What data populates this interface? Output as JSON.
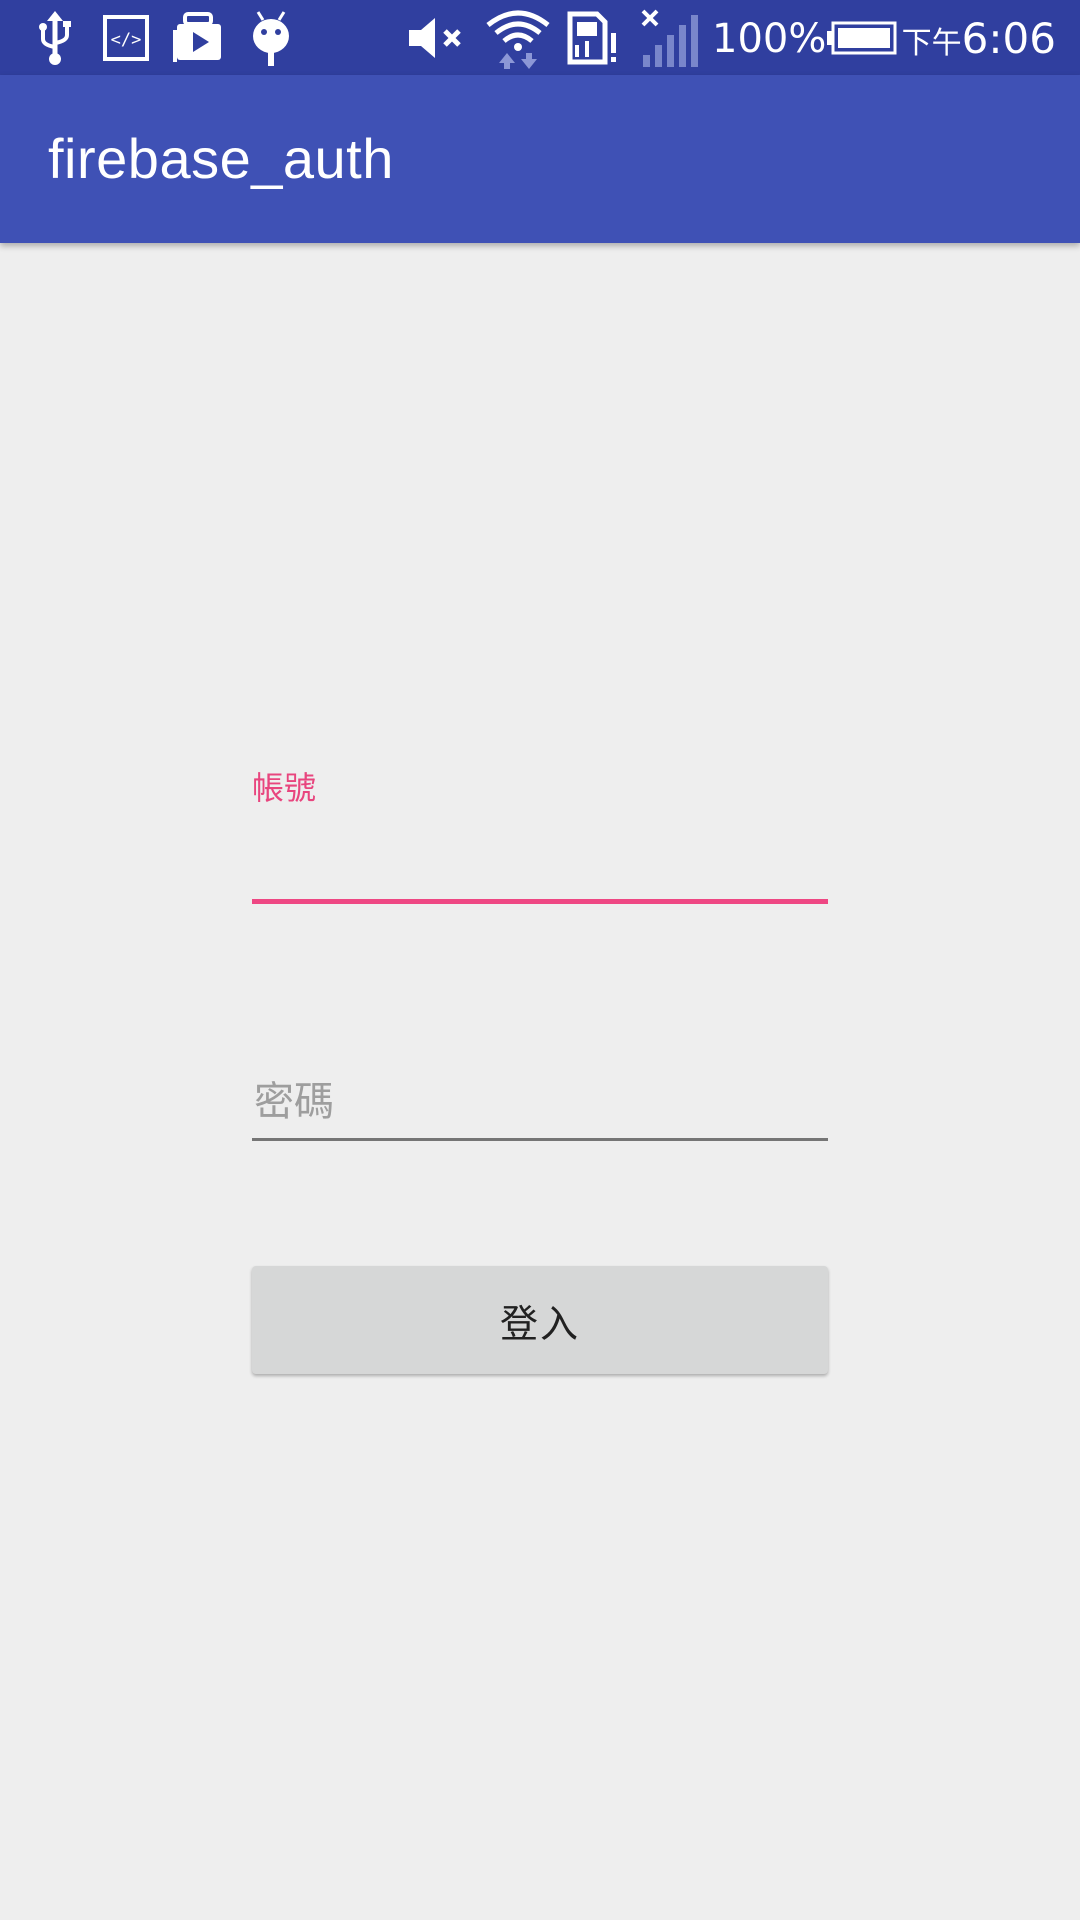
{
  "status_bar": {
    "icons_left": [
      "usb-icon",
      "code-icon",
      "play-store-icon",
      "android-icon"
    ],
    "icons_right": [
      "volume-muted-icon",
      "wifi-icon",
      "sim-alert-icon",
      "signal-icon",
      "battery-icon"
    ],
    "battery_percent": "100%",
    "time_prefix": "下午",
    "time": "6:06"
  },
  "app_bar": {
    "title": "firebase_auth"
  },
  "form": {
    "account_label": "帳號",
    "account_value": "",
    "password_placeholder": "密碼",
    "password_value": "",
    "login_label": "登入"
  },
  "colors": {
    "status_bar": "#303f9f",
    "primary": "#3f51b5",
    "accent": "#ee4783",
    "background": "#eeeeee",
    "button": "#d6d7d7"
  }
}
